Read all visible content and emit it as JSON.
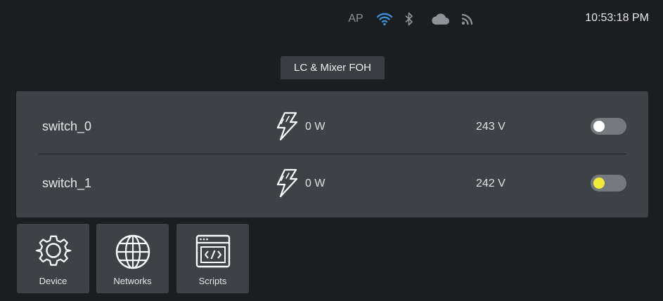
{
  "status_bar": {
    "ap_label": "AP",
    "icons": [
      "wifi-icon",
      "bluetooth-icon",
      "cloud-icon",
      "rss-icon"
    ],
    "clock": "10:53:18 PM",
    "colors": {
      "wifi": "#3d8fd6",
      "inactive": "#8f9397"
    }
  },
  "panel": {
    "title": "LC & Mixer FOH",
    "switches": [
      {
        "name": "switch_0",
        "power": "0 W",
        "voltage": "243 V",
        "icon": "lightning-icon",
        "knob_color": "#ffffff"
      },
      {
        "name": "switch_1",
        "power": "0 W",
        "voltage": "242 V",
        "icon": "lightning-icon",
        "knob_color": "#f2ea3a"
      }
    ]
  },
  "tiles": [
    {
      "label": "Device",
      "icon": "gear-icon"
    },
    {
      "label": "Networks",
      "icon": "globe-icon"
    },
    {
      "label": "Scripts",
      "icon": "code-window-icon"
    }
  ]
}
